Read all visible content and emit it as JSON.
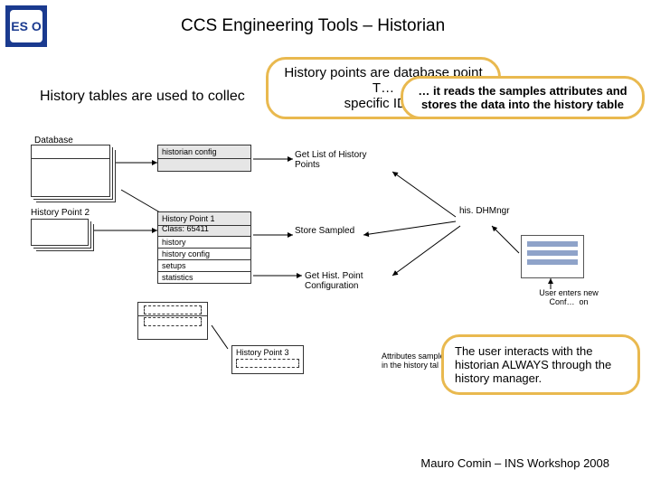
{
  "logo_text": "ES O",
  "title": "CCS Engineering Tools – Historian",
  "intro": "History tables are used to collec",
  "bubble_history_points": "History points are database point T…",
  "bubble_hp_line2": "specific ID : “",
  "bubble_reads": "… it reads the samples attributes and stores the data into the history table",
  "db_label": "Database",
  "hist_point_2": "History Point 2",
  "gb1_head": "historian config",
  "gb2_head1": "History Point 1",
  "gb2_head2": "Class: 65411",
  "gb2_rows": [
    "history",
    "history config",
    "setups",
    "statistics"
  ],
  "hp3": "History Point 3",
  "get_list": "Get List of History Points",
  "store": "Store Sampled",
  "get_conf": "Get Hist. Point Configuration",
  "hismgr": "his. DHMngr",
  "user_new": "User enters new Conf…  on",
  "attrs_sampled": "Attributes sampled by   stored in the history tal",
  "bubble_interacts": "The user interacts with the historian ALWAYS through the history manager.",
  "footer": "Mauro Comin – INS Workshop 2008"
}
